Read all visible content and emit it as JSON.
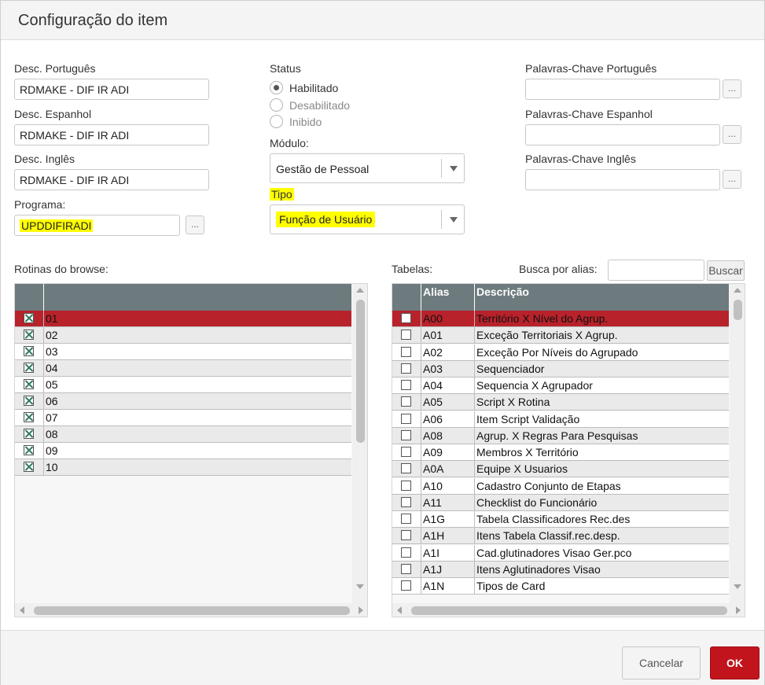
{
  "dialog": {
    "title": "Configuração do item"
  },
  "form": {
    "desc_pt_label": "Desc. Português",
    "desc_pt_value": "RDMAKE - DIF IR ADI",
    "desc_es_label": "Desc. Espanhol",
    "desc_es_value": "RDMAKE - DIF IR ADI",
    "desc_en_label": "Desc. Inglês",
    "desc_en_value": "RDMAKE - DIF IR ADI",
    "programa_label": "Programa:",
    "programa_value": "UPDDIFIRADI",
    "dots": "...",
    "status_label": "Status",
    "status_options": [
      "Habilitado",
      "Desabilitado",
      "Inibido"
    ],
    "modulo_label": "Módulo:",
    "modulo_value": "Gestão de Pessoal",
    "tipo_label": "Tipo",
    "tipo_value": "Função de Usuário",
    "kw_pt_label": "Palavras-Chave Português",
    "kw_es_label": "Palavras-Chave Espanhol",
    "kw_en_label": "Palavras-Chave Inglês"
  },
  "browse": {
    "label": "Rotinas do browse:",
    "rows": [
      "01",
      "02",
      "03",
      "04",
      "05",
      "06",
      "07",
      "08",
      "09",
      "10"
    ]
  },
  "tables": {
    "label": "Tabelas:",
    "search_label": "Busca por alias:",
    "search_button": "Buscar",
    "col_alias": "Alias",
    "col_desc": "Descrição",
    "rows": [
      {
        "alias": "A00",
        "desc": "Território X Nível do Agrup."
      },
      {
        "alias": "A01",
        "desc": "Exceção Territoriais X Agrup."
      },
      {
        "alias": "A02",
        "desc": "Exceção Por Níveis do Agrupado"
      },
      {
        "alias": "A03",
        "desc": "Sequenciador"
      },
      {
        "alias": "A04",
        "desc": "Sequencia X Agrupador"
      },
      {
        "alias": "A05",
        "desc": "Script X Rotina"
      },
      {
        "alias": "A06",
        "desc": "Item Script Validação"
      },
      {
        "alias": "A08",
        "desc": "Agrup. X Regras Para Pesquisas"
      },
      {
        "alias": "A09",
        "desc": "Membros X Território"
      },
      {
        "alias": "A0A",
        "desc": "Equipe X Usuarios"
      },
      {
        "alias": "A10",
        "desc": "Cadastro Conjunto de Etapas"
      },
      {
        "alias": "A11",
        "desc": "Checklist do Funcionário"
      },
      {
        "alias": "A1G",
        "desc": "Tabela Classificadores Rec.des"
      },
      {
        "alias": "A1H",
        "desc": "Itens Tabela Classif.rec.desp."
      },
      {
        "alias": "A1I",
        "desc": "Cad.glutinadores Visao Ger.pco"
      },
      {
        "alias": "A1J",
        "desc": "Itens Aglutinadores Visao"
      },
      {
        "alias": "A1N",
        "desc": "Tipos de Card"
      }
    ]
  },
  "footer": {
    "cancel": "Cancelar",
    "ok": "OK"
  },
  "colors": {
    "accent": "#c1141c",
    "selected_row": "#b8222a",
    "grid_header": "#6e7b7e",
    "highlight": "#ffff00"
  }
}
